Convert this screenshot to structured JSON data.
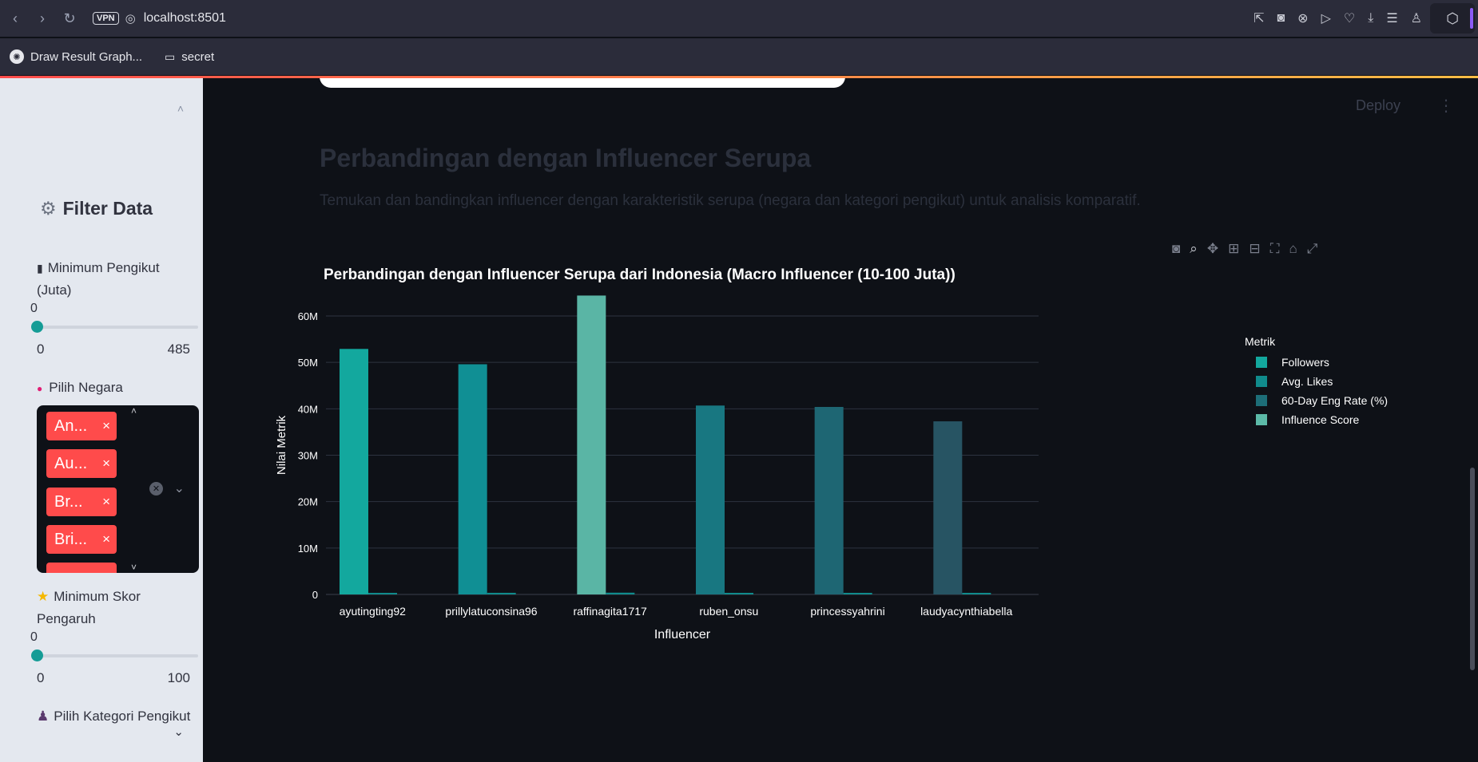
{
  "browser": {
    "url": "localhost:8501",
    "vpn_label": "VPN",
    "bookmarks": [
      {
        "label": "Draw Result Graph..."
      },
      {
        "label": "secret"
      }
    ]
  },
  "sidebar": {
    "title": "Filter Data",
    "min_followers": {
      "label": "Minimum Pengikut (Juta)",
      "value": "0",
      "min": "0",
      "max": "485",
      "fraction": 0
    },
    "country": {
      "label": "Pilih Negara",
      "tags": [
        "An...",
        "Au...",
        "Br...",
        "Bri..."
      ],
      "remove_glyph": "×"
    },
    "min_score": {
      "label": "Minimum Skor Pengaruh",
      "value": "0",
      "min": "0",
      "max": "100",
      "fraction": 0
    },
    "category": {
      "label": "Pilih Kategori Pengikut"
    }
  },
  "main": {
    "deploy_label": "Deploy",
    "title": "Perbandingan dengan Influencer Serupa",
    "subtitle": "Temukan dan bandingkan influencer dengan karakteristik serupa (negara dan kategori pengikut) untuk analisis komparatif."
  },
  "chart_data": {
    "type": "bar",
    "title": "Perbandingan dengan Influencer Serupa dari Indonesia (Macro Influencer (10-100 Juta))",
    "xlabel": "Influencer",
    "ylabel": "Nilai Metrik",
    "ylim": [
      0,
      65000000
    ],
    "yticks": [
      {
        "value": 0,
        "label": "0"
      },
      {
        "value": 10000000,
        "label": "10M"
      },
      {
        "value": 20000000,
        "label": "20M"
      },
      {
        "value": 30000000,
        "label": "30M"
      },
      {
        "value": 40000000,
        "label": "40M"
      },
      {
        "value": 50000000,
        "label": "50M"
      },
      {
        "value": 60000000,
        "label": "60M"
      }
    ],
    "grid": true,
    "legend_title": "Metrik",
    "legend_position": "right",
    "categories": [
      "ayutingting92",
      "prillylatuconsina96",
      "raffinagita1717",
      "ruben_onsu",
      "princessyahrini",
      "laudyacynthiabella"
    ],
    "bar_colors": [
      "#13a89e",
      "#108f94",
      "#5ab5a5",
      "#187781",
      "#1e6673",
      "#275463"
    ],
    "series": [
      {
        "name": "Followers",
        "color": "#13a89e",
        "values": [
          52900000,
          49600000,
          64400000,
          40700000,
          40400000,
          37300000
        ]
      },
      {
        "name": "Avg. Likes",
        "color": "#108b8c",
        "values": [
          170000,
          350000,
          380000,
          120000,
          80000,
          160000
        ]
      },
      {
        "name": "60-Day Eng Rate (%)",
        "color": "#1d6e78",
        "values": [
          0.3,
          0.7,
          0.6,
          0.3,
          0.2,
          0.4
        ]
      },
      {
        "name": "Influence Score",
        "color": "#5cbaa8",
        "values": [
          90,
          88,
          91,
          85,
          84,
          83
        ]
      }
    ]
  }
}
